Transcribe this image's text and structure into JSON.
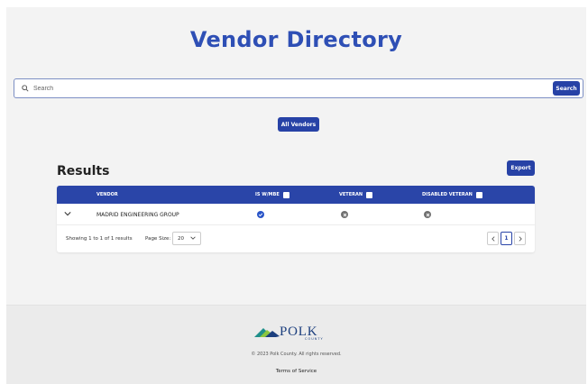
{
  "header": {
    "title": "Vendor Directory"
  },
  "search": {
    "placeholder": "Search",
    "value": "",
    "button_label": "Search"
  },
  "filters": {
    "all_vendors_label": "All Vendors"
  },
  "results": {
    "title": "Results",
    "export_label": "Export",
    "columns": {
      "vendor": "VENDOR",
      "is_wmbe": "IS W/MBE",
      "veteran": "VETERAN",
      "disabled_veteran": "DISABLED VETERAN"
    },
    "rows": [
      {
        "vendor": "MADRID ENGINEERING GROUP",
        "is_wmbe": true,
        "veteran": false,
        "disabled_veteran": false
      }
    ],
    "footer": {
      "showing_text": "Showing 1 to 1 of 1 results",
      "page_size_label": "Page Size:",
      "page_size_value": "20",
      "current_page": "1"
    }
  },
  "colors": {
    "primary": "#2a45a8",
    "title": "#2e4fb5",
    "check": "#2a55c8",
    "x_status": "#707070"
  },
  "footer": {
    "logo_text": "POLK",
    "logo_subtext": "COUNTY",
    "copyright": "© 2023 Polk County. All rights reserved.",
    "terms_label": "Terms of Service"
  }
}
